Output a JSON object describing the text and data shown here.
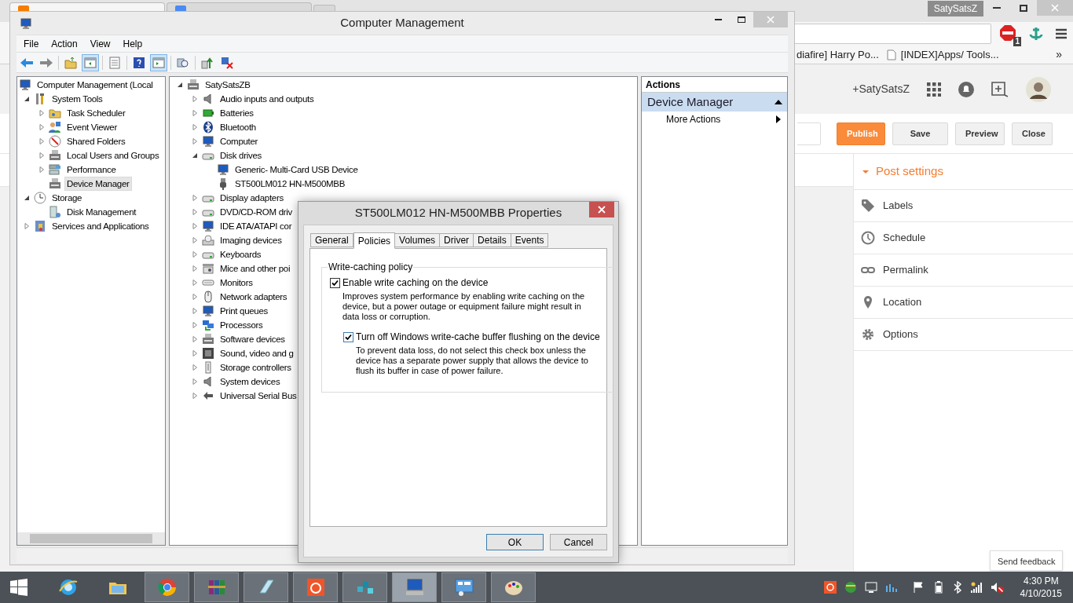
{
  "browser": {
    "tabs": [
      {
        "selected": true
      },
      {
        "selected": false
      }
    ],
    "profile": "SatySatsZ",
    "extension_badge": "1",
    "bookmarks": [
      "diafire] Harry Po...",
      "[INDEX]Apps/ Tools..."
    ],
    "bookmarks_more": "»"
  },
  "blogger": {
    "account": "+SatySatsZ",
    "actions": [
      {
        "label": "Publish",
        "kind": "primary"
      },
      {
        "label": "Save",
        "kind": "default"
      },
      {
        "label": "Preview",
        "kind": "default"
      },
      {
        "label": "Close",
        "kind": "default"
      }
    ],
    "post_settings": {
      "title": "Post settings",
      "expanded": true,
      "items": [
        "Labels",
        "Schedule",
        "Permalink",
        "Location",
        "Options"
      ]
    },
    "feedback": "Send feedback"
  },
  "window": {
    "title": "Computer Management",
    "menu": [
      "File",
      "Action",
      "View",
      "Help"
    ],
    "toolbar": [
      {
        "selected": false
      },
      {
        "selected": false
      },
      {
        "selected": false
      },
      {
        "selected": true
      },
      {
        "selected": false
      },
      {
        "selected": false
      },
      {
        "selected": true
      },
      {
        "selected": false
      },
      {
        "selected": false
      },
      {
        "selected": false
      }
    ],
    "nav_tree": [
      {
        "label": "Computer Management (Local",
        "selected": false,
        "children": [
          {
            "label": "System Tools",
            "expanded": true,
            "selected": false,
            "children": [
              {
                "label": "Task Scheduler",
                "expanded": false,
                "selected": false
              },
              {
                "label": "Event Viewer",
                "expanded": false,
                "selected": false
              },
              {
                "label": "Shared Folders",
                "expanded": false,
                "selected": false
              },
              {
                "label": "Local Users and Groups",
                "expanded": false,
                "selected": false
              },
              {
                "label": "Performance",
                "expanded": false,
                "selected": false
              },
              {
                "label": "Device Manager",
                "selected": true
              }
            ]
          },
          {
            "label": "Storage",
            "expanded": true,
            "selected": false,
            "children": [
              {
                "label": "Disk Management",
                "selected": false
              }
            ]
          },
          {
            "label": "Services and Applications",
            "expanded": false,
            "selected": false
          }
        ]
      }
    ],
    "device_tree": [
      {
        "label": "SatySatsZB",
        "expanded": true,
        "selected": false,
        "children": [
          {
            "label": "Audio inputs and outputs",
            "expanded": false,
            "selected": false
          },
          {
            "label": "Batteries",
            "expanded": false,
            "selected": false
          },
          {
            "label": "Bluetooth",
            "expanded": false,
            "selected": false
          },
          {
            "label": "Computer",
            "expanded": false,
            "selected": false
          },
          {
            "label": "Disk drives",
            "expanded": true,
            "selected": false,
            "children": [
              {
                "label": "Generic- Multi-Card USB Device",
                "selected": false
              },
              {
                "label": "ST500LM012 HN-M500MBB",
                "selected": false
              }
            ]
          },
          {
            "label": "Display adapters",
            "expanded": false,
            "selected": false
          },
          {
            "label": "DVD/CD-ROM driv",
            "expanded": false,
            "selected": false
          },
          {
            "label": "IDE ATA/ATAPI cor",
            "expanded": false,
            "selected": false
          },
          {
            "label": "Imaging devices",
            "expanded": false,
            "selected": false
          },
          {
            "label": "Keyboards",
            "expanded": false,
            "selected": false
          },
          {
            "label": "Mice and other poi",
            "expanded": false,
            "selected": false
          },
          {
            "label": "Monitors",
            "expanded": false,
            "selected": false
          },
          {
            "label": "Network adapters",
            "expanded": false,
            "selected": false
          },
          {
            "label": "Print queues",
            "expanded": false,
            "selected": false
          },
          {
            "label": "Processors",
            "expanded": false,
            "selected": false
          },
          {
            "label": "Software devices",
            "expanded": false,
            "selected": false
          },
          {
            "label": "Sound, video and g",
            "expanded": false,
            "selected": false
          },
          {
            "label": "Storage controllers",
            "expanded": false,
            "selected": false
          },
          {
            "label": "System devices",
            "expanded": false,
            "selected": false
          },
          {
            "label": "Universal Serial Bus",
            "expanded": false,
            "selected": false
          }
        ]
      }
    ],
    "actions": {
      "header": "Actions",
      "section": "Device Manager",
      "section_expanded": true,
      "items": [
        "More Actions"
      ]
    }
  },
  "dialog": {
    "title": "ST500LM012 HN-M500MBB Properties",
    "tabs": [
      {
        "label": "General",
        "selected": false
      },
      {
        "label": "Policies",
        "selected": true
      },
      {
        "label": "Volumes",
        "selected": false
      },
      {
        "label": "Driver",
        "selected": false
      },
      {
        "label": "Details",
        "selected": false
      },
      {
        "label": "Events",
        "selected": false
      }
    ],
    "group": "Write-caching policy",
    "options": [
      {
        "label": "Enable write caching on the device",
        "checked": true,
        "description": "Improves system performance by enabling write caching on the device, but a power outage or equipment failure might result in data loss or corruption."
      },
      {
        "label": "Turn off Windows write-cache buffer flushing on the device",
        "checked": true,
        "description": "To prevent data loss, do not select this check box unless the device has a separate power supply that allows the device to flush its buffer in case of power failure."
      }
    ],
    "buttons": [
      {
        "label": "OK",
        "kind": "default"
      },
      {
        "label": "Cancel",
        "kind": "normal"
      }
    ]
  },
  "taskbar": {
    "apps": [
      {
        "running": false,
        "selected": false
      },
      {
        "running": false,
        "selected": false
      },
      {
        "running": true,
        "selected": false
      },
      {
        "running": true,
        "selected": false
      },
      {
        "running": true,
        "selected": false
      },
      {
        "running": true,
        "selected": false
      },
      {
        "running": true,
        "selected": false
      },
      {
        "running": true,
        "selected": true
      },
      {
        "running": true,
        "selected": false
      },
      {
        "running": true,
        "selected": false
      }
    ],
    "time": "4:30 PM",
    "date": "4/10/2015"
  }
}
